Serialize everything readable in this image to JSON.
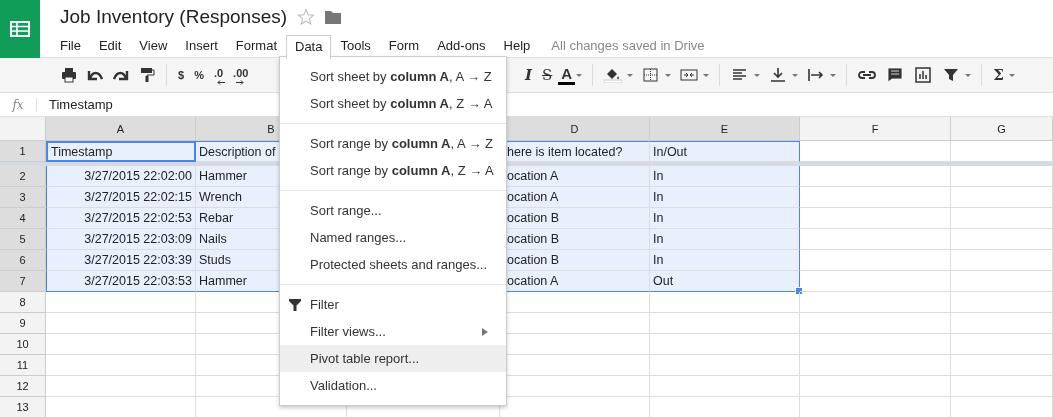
{
  "document": {
    "title": "Job Inventory (Responses)",
    "starred": false
  },
  "menubar": [
    {
      "label": "File",
      "selected": false
    },
    {
      "label": "Edit",
      "selected": false
    },
    {
      "label": "View",
      "selected": false
    },
    {
      "label": "Insert",
      "selected": false
    },
    {
      "label": "Format",
      "selected": false
    },
    {
      "label": "Data",
      "selected": true
    },
    {
      "label": "Tools",
      "selected": false
    },
    {
      "label": "Form",
      "selected": false
    },
    {
      "label": "Add-ons",
      "selected": false
    },
    {
      "label": "Help",
      "selected": false
    }
  ],
  "save_status": "All changes saved in Drive",
  "toolbar_left": [
    {
      "kind": "print"
    },
    {
      "kind": "undo"
    },
    {
      "kind": "redo"
    },
    {
      "kind": "paint"
    },
    {
      "kind": "sep"
    },
    {
      "kind": "text",
      "label": "$"
    },
    {
      "kind": "text",
      "label": "%"
    },
    {
      "kind": "decrease",
      "label": ".0"
    },
    {
      "kind": "increase",
      "label": ".00"
    }
  ],
  "toolbar_right": [
    {
      "kind": "italic",
      "label": "I"
    },
    {
      "kind": "strike",
      "label": "S"
    },
    {
      "kind": "color",
      "label": "A",
      "dropdown": true
    },
    {
      "kind": "sep"
    },
    {
      "kind": "fill",
      "dropdown": true
    },
    {
      "kind": "borders",
      "dropdown": true
    },
    {
      "kind": "merge",
      "dropdown": true
    },
    {
      "kind": "sep"
    },
    {
      "kind": "align",
      "dropdown": true
    },
    {
      "kind": "valign",
      "dropdown": true
    },
    {
      "kind": "wrap",
      "dropdown": true
    },
    {
      "kind": "sep"
    },
    {
      "kind": "link"
    },
    {
      "kind": "comment"
    },
    {
      "kind": "chart"
    },
    {
      "kind": "filter",
      "dropdown": true
    },
    {
      "kind": "sep"
    },
    {
      "kind": "text",
      "label": "Σ",
      "dropdown": true
    }
  ],
  "formula_bar": {
    "label": "fx",
    "value": "Timestamp"
  },
  "columns": [
    {
      "label": "A",
      "selected": true
    },
    {
      "label": "B",
      "selected": true
    },
    {},
    {
      "label": "D",
      "selected": true
    },
    {
      "label": "E",
      "selected": true
    },
    {
      "label": "F",
      "selected": false
    },
    {
      "label": "G",
      "selected": false
    }
  ],
  "rows": [
    {
      "number": "1",
      "selected": true,
      "cells": [
        {
          "text": "Timestamp",
          "active": true
        },
        {
          "text": "Description of"
        },
        {},
        {
          "text": "here is item located?"
        },
        {
          "text": "In/Out"
        },
        {},
        {}
      ]
    },
    {
      "number": "2",
      "selected": true,
      "cells": [
        {
          "text": "3/27/2015 22:02:00",
          "kind": "date"
        },
        {
          "text": "Hammer"
        },
        {},
        {
          "text": "ocation A"
        },
        {
          "text": "In"
        },
        {},
        {}
      ]
    },
    {
      "number": "3",
      "selected": true,
      "cells": [
        {
          "text": "3/27/2015 22:02:15",
          "kind": "date"
        },
        {
          "text": "Wrench"
        },
        {},
        {
          "text": "ocation A"
        },
        {
          "text": "In"
        },
        {},
        {}
      ]
    },
    {
      "number": "4",
      "selected": true,
      "cells": [
        {
          "text": "3/27/2015 22:02:53",
          "kind": "date"
        },
        {
          "text": "Rebar"
        },
        {},
        {
          "text": "ocation B"
        },
        {
          "text": "In"
        },
        {},
        {}
      ]
    },
    {
      "number": "5",
      "selected": true,
      "cells": [
        {
          "text": "3/27/2015 22:03:09",
          "kind": "date"
        },
        {
          "text": "Nails"
        },
        {},
        {
          "text": "ocation B"
        },
        {
          "text": "In"
        },
        {},
        {}
      ]
    },
    {
      "number": "6",
      "selected": true,
      "cells": [
        {
          "text": "3/27/2015 22:03:39",
          "kind": "date"
        },
        {
          "text": "Studs"
        },
        {},
        {
          "text": "ocation B"
        },
        {
          "text": "In"
        },
        {},
        {}
      ]
    },
    {
      "number": "7",
      "selected": true,
      "cells": [
        {
          "text": "3/27/2015 22:03:53",
          "kind": "date"
        },
        {
          "text": "Hammer"
        },
        {},
        {
          "text": "ocation A"
        },
        {
          "text": "Out"
        },
        {},
        {}
      ]
    },
    {
      "number": "8",
      "selected": false,
      "cells": [
        {},
        {},
        {},
        {},
        {},
        {},
        {}
      ]
    },
    {
      "number": "9",
      "selected": false,
      "cells": [
        {},
        {},
        {},
        {},
        {},
        {},
        {}
      ]
    },
    {
      "number": "10",
      "selected": false,
      "cells": [
        {},
        {},
        {},
        {},
        {},
        {},
        {}
      ]
    },
    {
      "number": "11",
      "selected": false,
      "cells": [
        {},
        {},
        {},
        {},
        {},
        {},
        {}
      ]
    },
    {
      "number": "12",
      "selected": false,
      "cells": [
        {},
        {},
        {},
        {},
        {},
        {},
        {}
      ]
    },
    {
      "number": "13",
      "selected": false,
      "cells": [
        {},
        {},
        {},
        {},
        {},
        {},
        {}
      ]
    }
  ],
  "data_menu": [
    {
      "kind": "item",
      "label": "Sort sheet by **column A**, A → Z",
      "selected": false
    },
    {
      "kind": "item",
      "label": "Sort sheet by **column A**, Z → A",
      "selected": false
    },
    {
      "kind": "separator"
    },
    {
      "kind": "item",
      "label": "Sort range by **column A**, A → Z",
      "selected": false
    },
    {
      "kind": "item",
      "label": "Sort range by **column A**, Z → A",
      "selected": false
    },
    {
      "kind": "separator"
    },
    {
      "kind": "item",
      "label": "Sort range...",
      "selected": false
    },
    {
      "kind": "item",
      "label": "Named ranges...",
      "selected": false
    },
    {
      "kind": "item",
      "label": "Protected sheets and ranges...",
      "selected": false
    },
    {
      "kind": "separator"
    },
    {
      "kind": "item",
      "label": "Filter",
      "selected": false,
      "icon": true
    },
    {
      "kind": "item",
      "label": "Filter views...",
      "selected": false,
      "submenu": true
    },
    {
      "kind": "item",
      "label": "Pivot table report...",
      "selected": true
    },
    {
      "kind": "item",
      "label": "Validation...",
      "selected": false
    }
  ]
}
